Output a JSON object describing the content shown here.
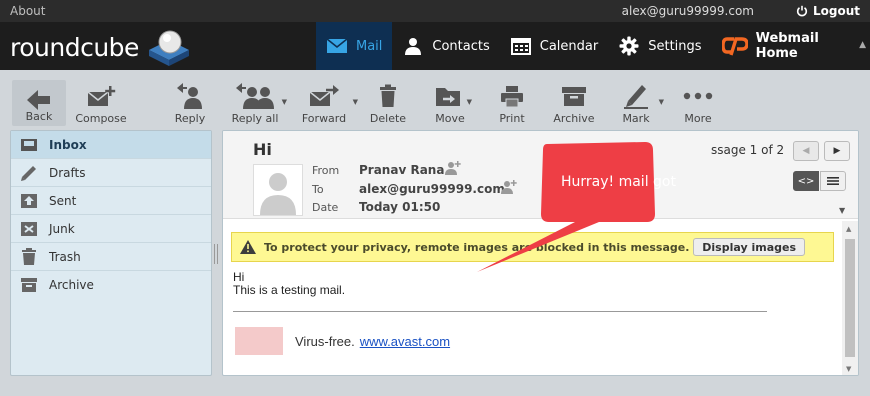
{
  "topbar": {
    "about": "About",
    "user": "alex@guru99999.com",
    "logout": "Logout"
  },
  "logo": "roundcube",
  "tasks": [
    {
      "label": "Mail",
      "icon": "mail-icon",
      "selected": true
    },
    {
      "label": "Contacts",
      "icon": "contacts-icon",
      "selected": false
    },
    {
      "label": "Calendar",
      "icon": "calendar-icon",
      "selected": false
    },
    {
      "label": "Settings",
      "icon": "gear-icon",
      "selected": false
    },
    {
      "label": "Webmail Home",
      "icon": "cpanel-icon",
      "selected": false
    }
  ],
  "toolbar": {
    "back": "Back",
    "compose": "Compose",
    "reply": "Reply",
    "reply_all": "Reply all",
    "forward": "Forward",
    "delete": "Delete",
    "move": "Move",
    "print": "Print",
    "archive": "Archive",
    "mark": "Mark",
    "more": "More"
  },
  "folders": [
    {
      "label": "Inbox",
      "icon": "inbox-icon",
      "selected": true
    },
    {
      "label": "Drafts",
      "icon": "pencil-icon",
      "selected": false
    },
    {
      "label": "Sent",
      "icon": "sent-icon",
      "selected": false
    },
    {
      "label": "Junk",
      "icon": "junk-icon",
      "selected": false
    },
    {
      "label": "Trash",
      "icon": "trash-icon",
      "selected": false
    },
    {
      "label": "Archive",
      "icon": "archive-icon",
      "selected": false
    }
  ],
  "message": {
    "subject": "Hi",
    "from_label": "From",
    "from": "Pranav Rana",
    "to_label": "To",
    "to": "alex@guru99999.com",
    "date_label": "Date",
    "date": "Today 01:50",
    "counter": "ssage 1 of 2",
    "remote_warning": "To protect your privacy, remote images are blocked in this message.",
    "display_images": "Display images",
    "body_line1": "Hi",
    "body_line2": "This is a testing mail.",
    "virus_text": "Virus-free.",
    "virus_link": "www.avast.com"
  },
  "callout": {
    "text": "Hurray! mail got",
    "color": "#ee3e45"
  },
  "colors": {
    "accent": "#37a5e5",
    "header_bg": "#1d1d1d",
    "warning_bg": "#fef893"
  }
}
